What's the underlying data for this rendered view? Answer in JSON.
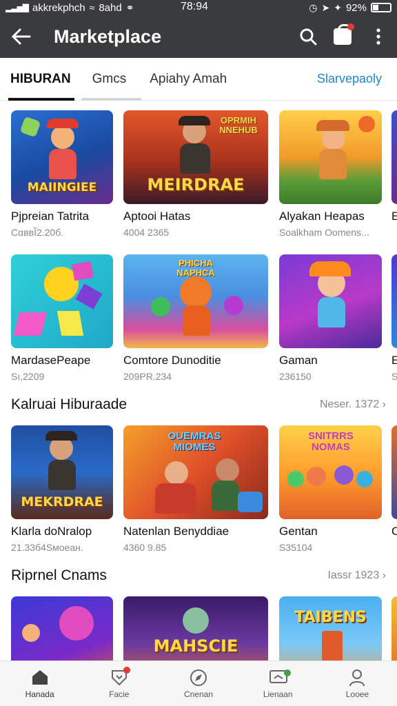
{
  "status_bar": {
    "left_text": "akkrekphch",
    "network": "8ahd",
    "time": "78:94",
    "battery": "92%"
  },
  "app_bar": {
    "title": "Marketplace",
    "back_icon": "back-arrow-icon",
    "search_icon": "search-icon",
    "bag_icon": "shopping-bag-icon",
    "more_icon": "more-vert-icon"
  },
  "tabs": [
    {
      "label": "HIBURAN",
      "active": true
    },
    {
      "label": "Gmcs",
      "active": false
    },
    {
      "label": "Apiahy Amah",
      "active": false
    }
  ],
  "tabs_link": "Slarvepaoly",
  "rows": [
    {
      "cards": [
        {
          "name": "Pjpreian Tatrita",
          "sub": "CαввĨ2.20б.",
          "art": "MAIINGIEE"
        },
        {
          "name": "Aptooi Hatas",
          "sub": "4004 2365",
          "art": "MEIRDRAE",
          "art_top": "OPRMIH NNEHUB"
        },
        {
          "name": "Alyakan Heapas",
          "sub": "Soalkham Oomens...",
          "art": ""
        },
        {
          "name": "E",
          "sub": ""
        }
      ]
    },
    {
      "cards": [
        {
          "name": "MardasePeape",
          "sub": "Sı,2209",
          "art": ""
        },
        {
          "name": "Comtore Dunoditie",
          "sub": "209PR.234",
          "art": "",
          "art_top": "PHICHA NAPHCA"
        },
        {
          "name": "Gaman",
          "sub": "236150",
          "art": ""
        },
        {
          "name": "E",
          "sub": "S"
        }
      ]
    }
  ],
  "sections": [
    {
      "title": "Kalruai Hiburaade",
      "more": "Neser. 1372 ›",
      "cards": [
        {
          "name": "Klarla doNralop",
          "sub": "21.33б4Sмоеан.",
          "art": "MEKRDRAE"
        },
        {
          "name": "Natenlan Benyddiae",
          "sub": "4360 9.85",
          "art": "",
          "art_top": "OUEMRAS MIOMES"
        },
        {
          "name": "Gentan",
          "sub": "S35104",
          "art": "",
          "art_top": "SNITRRS NOMAS"
        },
        {
          "name": "C",
          "sub": ""
        }
      ]
    },
    {
      "title": "Riprnel Cnams",
      "more": "Iassr 1923 ›",
      "cards": [
        {
          "name": "",
          "sub": "",
          "art": ""
        },
        {
          "name": "",
          "sub": "",
          "art": "MAHSCIE"
        },
        {
          "name": "",
          "sub": "",
          "art": "TAIBENS"
        },
        {
          "name": "",
          "sub": ""
        }
      ]
    }
  ],
  "bottom_nav": [
    {
      "label": "Hanada",
      "icon": "home-icon"
    },
    {
      "label": "Facie",
      "icon": "shield-heart-icon"
    },
    {
      "label": "Cnenan",
      "icon": "compass-icon"
    },
    {
      "label": "Lienaan",
      "icon": "tv-icon"
    },
    {
      "label": "Looee",
      "icon": "profile-icon"
    }
  ],
  "colors": {
    "app_bar": "#3a3b3d",
    "tab_link": "#1e88c8",
    "badge_red": "#e53935",
    "badge_green": "#43a047"
  }
}
